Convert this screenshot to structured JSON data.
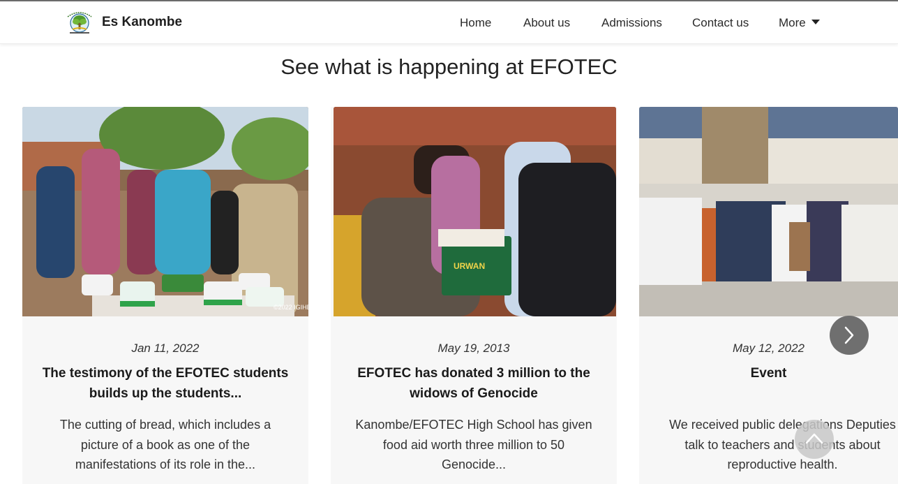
{
  "brand": {
    "name": "Es Kanombe",
    "logo_icon": "school-crest-logo"
  },
  "nav": {
    "items": [
      {
        "label": "Home"
      },
      {
        "label": "About us"
      },
      {
        "label": "Admissions"
      },
      {
        "label": "Contact us"
      },
      {
        "label": "More"
      }
    ]
  },
  "section": {
    "title": "See what is happening at EFOTEC"
  },
  "cards": [
    {
      "date": "Jan 11, 2022",
      "title": "The testimony of the EFOTEC students builds up the students...",
      "excerpt": "The cutting of bread, which includes a picture of a book as one of the manifestations of its role in the...",
      "photo_credit": "©2022 IGIHE"
    },
    {
      "date": "May 19, 2013",
      "title": "EFOTEC has donated 3 million to the widows of Genocide",
      "excerpt": "Kanombe/EFOTEC High School has given food aid worth three million to 50 Genocide...",
      "box_text": "URWAN"
    },
    {
      "date": "May 12, 2022",
      "title": "Event",
      "excerpt": "We received public delegations Deputies talk to teachers and students about reproductive health."
    }
  ],
  "controls": {
    "next_icon": "chevron-right-icon",
    "scroll_top_icon": "chevron-up-icon"
  },
  "colors": {
    "next_button": "#6f6f6f",
    "card_background": "#f7f7f7"
  }
}
